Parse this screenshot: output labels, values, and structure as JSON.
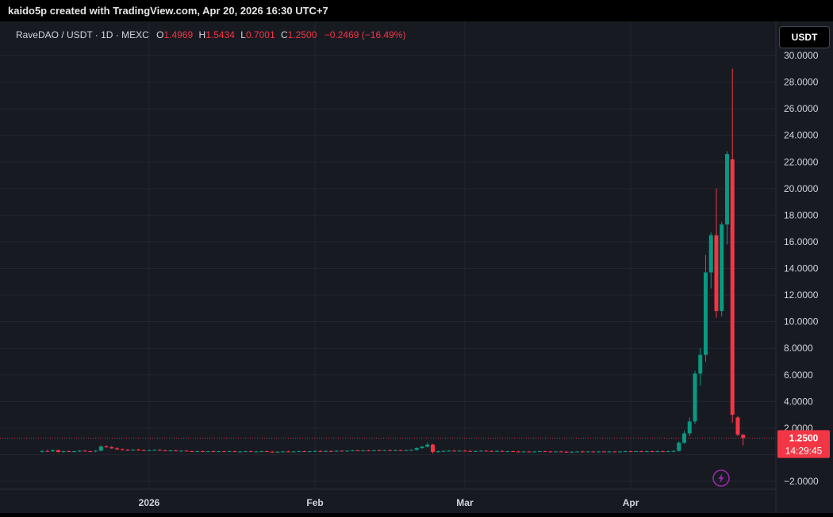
{
  "header": {
    "attribution": "kaido5p created with TradingView.com, Apr 20, 2026 16:30 UTC+7"
  },
  "legend": {
    "symbol": "RaveDAO / USDT · 1D · MEXC",
    "open_label": "O",
    "open": "1.4969",
    "high_label": "H",
    "high": "1.5434",
    "low_label": "L",
    "low": "0.7001",
    "close_label": "C",
    "close": "1.2500",
    "change": "−0.2469 (−16.49%)"
  },
  "toolbar": {
    "currency_label": "USDT"
  },
  "price_tag": {
    "price": "1.2500",
    "countdown": "14:29:45"
  },
  "icons": {
    "bolt": "lightning-bolt-icon"
  },
  "colors": {
    "bullish": "#089981",
    "bearish": "#f23645",
    "background": "#181a22",
    "grid": "#232630",
    "text": "#d1d4dc",
    "bolt": "#9c27b0"
  },
  "chart_data": {
    "type": "candlestick",
    "interval": "1D",
    "exchange": "MEXC",
    "symbol": "RaveDAO / USDT",
    "ylim": [
      -3,
      31
    ],
    "y_ticks": [
      "30.0000",
      "28.0000",
      "26.0000",
      "24.0000",
      "22.0000",
      "20.0000",
      "18.0000",
      "16.0000",
      "14.0000",
      "12.0000",
      "10.0000",
      "8.0000",
      "6.0000",
      "4.0000",
      "2.0000",
      "−2.0000"
    ],
    "y_tick_values": [
      30,
      28,
      26,
      24,
      22,
      20,
      18,
      16,
      14,
      12,
      10,
      8,
      6,
      4,
      2,
      -2
    ],
    "x_labels": [
      "2026",
      "Feb",
      "Mar",
      "Apr"
    ],
    "x_label_dates": [
      "2026-01-01",
      "2026-02-01",
      "2026-03-01",
      "2026-04-01"
    ],
    "grid": true,
    "last_price": 1.25,
    "candles": [
      {
        "date": "2025-12-12",
        "open": 0.22,
        "high": 0.34,
        "low": 0.16,
        "close": 0.28
      },
      {
        "date": "2025-12-13",
        "open": 0.28,
        "high": 0.36,
        "low": 0.2,
        "close": 0.26
      },
      {
        "date": "2025-12-14",
        "open": 0.26,
        "high": 0.4,
        "low": 0.2,
        "close": 0.34
      },
      {
        "date": "2025-12-15",
        "open": 0.34,
        "high": 0.38,
        "low": 0.16,
        "close": 0.2
      },
      {
        "date": "2025-12-16",
        "open": 0.2,
        "high": 0.3,
        "low": 0.16,
        "close": 0.26
      },
      {
        "date": "2025-12-17",
        "open": 0.26,
        "high": 0.32,
        "low": 0.2,
        "close": 0.24
      },
      {
        "date": "2025-12-18",
        "open": 0.24,
        "high": 0.3,
        "low": 0.18,
        "close": 0.26
      },
      {
        "date": "2025-12-19",
        "open": 0.26,
        "high": 0.34,
        "low": 0.2,
        "close": 0.3
      },
      {
        "date": "2025-12-20",
        "open": 0.3,
        "high": 0.36,
        "low": 0.24,
        "close": 0.26
      },
      {
        "date": "2025-12-21",
        "open": 0.26,
        "high": 0.3,
        "low": 0.2,
        "close": 0.24
      },
      {
        "date": "2025-12-22",
        "open": 0.24,
        "high": 0.34,
        "low": 0.18,
        "close": 0.3
      },
      {
        "date": "2025-12-23",
        "open": 0.3,
        "high": 0.7,
        "low": 0.26,
        "close": 0.62
      },
      {
        "date": "2025-12-24",
        "open": 0.62,
        "high": 0.72,
        "low": 0.5,
        "close": 0.56
      },
      {
        "date": "2025-12-25",
        "open": 0.56,
        "high": 0.66,
        "low": 0.44,
        "close": 0.48
      },
      {
        "date": "2025-12-26",
        "open": 0.48,
        "high": 0.56,
        "low": 0.36,
        "close": 0.4
      },
      {
        "date": "2025-12-27",
        "open": 0.4,
        "high": 0.48,
        "low": 0.32,
        "close": 0.36
      },
      {
        "date": "2025-12-28",
        "open": 0.36,
        "high": 0.44,
        "low": 0.28,
        "close": 0.32
      },
      {
        "date": "2025-12-29",
        "open": 0.32,
        "high": 0.42,
        "low": 0.28,
        "close": 0.38
      },
      {
        "date": "2025-12-30",
        "open": 0.38,
        "high": 0.44,
        "low": 0.3,
        "close": 0.34
      },
      {
        "date": "2025-12-31",
        "open": 0.34,
        "high": 0.4,
        "low": 0.28,
        "close": 0.3
      },
      {
        "date": "2026-01-01",
        "open": 0.3,
        "high": 0.38,
        "low": 0.26,
        "close": 0.34
      },
      {
        "date": "2026-01-02",
        "open": 0.34,
        "high": 0.4,
        "low": 0.28,
        "close": 0.36
      },
      {
        "date": "2026-01-03",
        "open": 0.36,
        "high": 0.42,
        "low": 0.3,
        "close": 0.32
      },
      {
        "date": "2026-01-04",
        "open": 0.32,
        "high": 0.38,
        "low": 0.26,
        "close": 0.3
      },
      {
        "date": "2026-01-05",
        "open": 0.3,
        "high": 0.36,
        "low": 0.24,
        "close": 0.32
      },
      {
        "date": "2026-01-06",
        "open": 0.32,
        "high": 0.38,
        "low": 0.26,
        "close": 0.28
      },
      {
        "date": "2026-01-07",
        "open": 0.28,
        "high": 0.34,
        "low": 0.22,
        "close": 0.3
      },
      {
        "date": "2026-01-08",
        "open": 0.3,
        "high": 0.34,
        "low": 0.24,
        "close": 0.26
      },
      {
        "date": "2026-01-09",
        "open": 0.26,
        "high": 0.32,
        "low": 0.2,
        "close": 0.24
      },
      {
        "date": "2026-01-10",
        "open": 0.24,
        "high": 0.3,
        "low": 0.2,
        "close": 0.26
      },
      {
        "date": "2026-01-11",
        "open": 0.26,
        "high": 0.32,
        "low": 0.2,
        "close": 0.24
      },
      {
        "date": "2026-01-12",
        "open": 0.24,
        "high": 0.28,
        "low": 0.18,
        "close": 0.26
      },
      {
        "date": "2026-01-13",
        "open": 0.26,
        "high": 0.32,
        "low": 0.2,
        "close": 0.22
      },
      {
        "date": "2026-01-14",
        "open": 0.22,
        "high": 0.28,
        "low": 0.18,
        "close": 0.26
      },
      {
        "date": "2026-01-15",
        "open": 0.26,
        "high": 0.3,
        "low": 0.2,
        "close": 0.24
      },
      {
        "date": "2026-01-16",
        "open": 0.24,
        "high": 0.3,
        "low": 0.2,
        "close": 0.26
      },
      {
        "date": "2026-01-17",
        "open": 0.26,
        "high": 0.3,
        "low": 0.2,
        "close": 0.22
      },
      {
        "date": "2026-01-18",
        "open": 0.22,
        "high": 0.28,
        "low": 0.18,
        "close": 0.24
      },
      {
        "date": "2026-01-19",
        "open": 0.24,
        "high": 0.3,
        "low": 0.18,
        "close": 0.26
      },
      {
        "date": "2026-01-20",
        "open": 0.26,
        "high": 0.3,
        "low": 0.2,
        "close": 0.22
      },
      {
        "date": "2026-01-21",
        "open": 0.22,
        "high": 0.28,
        "low": 0.18,
        "close": 0.24
      },
      {
        "date": "2026-01-22",
        "open": 0.24,
        "high": 0.3,
        "low": 0.2,
        "close": 0.26
      },
      {
        "date": "2026-01-23",
        "open": 0.26,
        "high": 0.3,
        "low": 0.2,
        "close": 0.22
      },
      {
        "date": "2026-01-24",
        "open": 0.22,
        "high": 0.28,
        "low": 0.16,
        "close": 0.2
      },
      {
        "date": "2026-01-25",
        "open": 0.2,
        "high": 0.26,
        "low": 0.14,
        "close": 0.22
      },
      {
        "date": "2026-01-26",
        "open": 0.22,
        "high": 0.28,
        "low": 0.18,
        "close": 0.24
      },
      {
        "date": "2026-01-27",
        "open": 0.24,
        "high": 0.3,
        "low": 0.2,
        "close": 0.22
      },
      {
        "date": "2026-01-28",
        "open": 0.22,
        "high": 0.28,
        "low": 0.18,
        "close": 0.24
      },
      {
        "date": "2026-01-29",
        "open": 0.24,
        "high": 0.3,
        "low": 0.2,
        "close": 0.26
      },
      {
        "date": "2026-01-30",
        "open": 0.26,
        "high": 0.3,
        "low": 0.2,
        "close": 0.24
      },
      {
        "date": "2026-01-31",
        "open": 0.24,
        "high": 0.28,
        "low": 0.18,
        "close": 0.26
      },
      {
        "date": "2026-02-01",
        "open": 0.26,
        "high": 0.32,
        "low": 0.2,
        "close": 0.28
      },
      {
        "date": "2026-02-02",
        "open": 0.28,
        "high": 0.34,
        "low": 0.22,
        "close": 0.26
      },
      {
        "date": "2026-02-03",
        "open": 0.26,
        "high": 0.32,
        "low": 0.2,
        "close": 0.28
      },
      {
        "date": "2026-02-04",
        "open": 0.28,
        "high": 0.32,
        "low": 0.22,
        "close": 0.26
      },
      {
        "date": "2026-02-05",
        "open": 0.26,
        "high": 0.32,
        "low": 0.2,
        "close": 0.3
      },
      {
        "date": "2026-02-06",
        "open": 0.3,
        "high": 0.34,
        "low": 0.24,
        "close": 0.28
      },
      {
        "date": "2026-02-07",
        "open": 0.28,
        "high": 0.32,
        "low": 0.22,
        "close": 0.3
      },
      {
        "date": "2026-02-08",
        "open": 0.3,
        "high": 0.36,
        "low": 0.26,
        "close": 0.32
      },
      {
        "date": "2026-02-09",
        "open": 0.32,
        "high": 0.36,
        "low": 0.26,
        "close": 0.3
      },
      {
        "date": "2026-02-10",
        "open": 0.3,
        "high": 0.34,
        "low": 0.24,
        "close": 0.32
      },
      {
        "date": "2026-02-11",
        "open": 0.32,
        "high": 0.36,
        "low": 0.26,
        "close": 0.3
      },
      {
        "date": "2026-02-12",
        "open": 0.3,
        "high": 0.36,
        "low": 0.24,
        "close": 0.34
      },
      {
        "date": "2026-02-13",
        "open": 0.34,
        "high": 0.38,
        "low": 0.28,
        "close": 0.32
      },
      {
        "date": "2026-02-14",
        "open": 0.32,
        "high": 0.36,
        "low": 0.26,
        "close": 0.34
      },
      {
        "date": "2026-02-15",
        "open": 0.34,
        "high": 0.38,
        "low": 0.28,
        "close": 0.32
      },
      {
        "date": "2026-02-16",
        "open": 0.32,
        "high": 0.38,
        "low": 0.28,
        "close": 0.34
      },
      {
        "date": "2026-02-17",
        "open": 0.34,
        "high": 0.38,
        "low": 0.28,
        "close": 0.32
      },
      {
        "date": "2026-02-18",
        "open": 0.32,
        "high": 0.36,
        "low": 0.26,
        "close": 0.34
      },
      {
        "date": "2026-02-19",
        "open": 0.34,
        "high": 0.4,
        "low": 0.3,
        "close": 0.36
      },
      {
        "date": "2026-02-20",
        "open": 0.36,
        "high": 0.56,
        "low": 0.3,
        "close": 0.5
      },
      {
        "date": "2026-02-21",
        "open": 0.5,
        "high": 0.66,
        "low": 0.44,
        "close": 0.6
      },
      {
        "date": "2026-02-22",
        "open": 0.6,
        "high": 0.9,
        "low": 0.54,
        "close": 0.76
      },
      {
        "date": "2026-02-23",
        "open": 0.76,
        "high": 0.82,
        "low": 0.1,
        "close": 0.2
      },
      {
        "date": "2026-02-24",
        "open": 0.2,
        "high": 0.3,
        "low": 0.14,
        "close": 0.26
      },
      {
        "date": "2026-02-25",
        "open": 0.26,
        "high": 0.32,
        "low": 0.2,
        "close": 0.28
      },
      {
        "date": "2026-02-26",
        "open": 0.28,
        "high": 0.34,
        "low": 0.22,
        "close": 0.3
      },
      {
        "date": "2026-02-27",
        "open": 0.3,
        "high": 0.36,
        "low": 0.24,
        "close": 0.28
      },
      {
        "date": "2026-02-28",
        "open": 0.28,
        "high": 0.34,
        "low": 0.22,
        "close": 0.3
      },
      {
        "date": "2026-03-01",
        "open": 0.3,
        "high": 0.36,
        "low": 0.24,
        "close": 0.28
      },
      {
        "date": "2026-03-02",
        "open": 0.28,
        "high": 0.34,
        "low": 0.22,
        "close": 0.26
      },
      {
        "date": "2026-03-03",
        "open": 0.26,
        "high": 0.32,
        "low": 0.2,
        "close": 0.28
      },
      {
        "date": "2026-03-04",
        "open": 0.28,
        "high": 0.34,
        "low": 0.22,
        "close": 0.3
      },
      {
        "date": "2026-03-05",
        "open": 0.3,
        "high": 0.34,
        "low": 0.24,
        "close": 0.28
      },
      {
        "date": "2026-03-06",
        "open": 0.28,
        "high": 0.32,
        "low": 0.22,
        "close": 0.26
      },
      {
        "date": "2026-03-07",
        "open": 0.26,
        "high": 0.32,
        "low": 0.2,
        "close": 0.28
      },
      {
        "date": "2026-03-08",
        "open": 0.28,
        "high": 0.32,
        "low": 0.22,
        "close": 0.24
      },
      {
        "date": "2026-03-09",
        "open": 0.24,
        "high": 0.3,
        "low": 0.2,
        "close": 0.26
      },
      {
        "date": "2026-03-10",
        "open": 0.26,
        "high": 0.3,
        "low": 0.2,
        "close": 0.24
      },
      {
        "date": "2026-03-11",
        "open": 0.24,
        "high": 0.3,
        "low": 0.18,
        "close": 0.22
      },
      {
        "date": "2026-03-12",
        "open": 0.22,
        "high": 0.28,
        "low": 0.18,
        "close": 0.24
      },
      {
        "date": "2026-03-13",
        "open": 0.24,
        "high": 0.28,
        "low": 0.18,
        "close": 0.22
      },
      {
        "date": "2026-03-14",
        "open": 0.22,
        "high": 0.28,
        "low": 0.18,
        "close": 0.24
      },
      {
        "date": "2026-03-15",
        "open": 0.24,
        "high": 0.3,
        "low": 0.2,
        "close": 0.26
      },
      {
        "date": "2026-03-16",
        "open": 0.26,
        "high": 0.3,
        "low": 0.2,
        "close": 0.24
      },
      {
        "date": "2026-03-17",
        "open": 0.24,
        "high": 0.28,
        "low": 0.18,
        "close": 0.22
      },
      {
        "date": "2026-03-18",
        "open": 0.22,
        "high": 0.28,
        "low": 0.18,
        "close": 0.24
      },
      {
        "date": "2026-03-19",
        "open": 0.24,
        "high": 0.3,
        "low": 0.2,
        "close": 0.22
      },
      {
        "date": "2026-03-20",
        "open": 0.22,
        "high": 0.28,
        "low": 0.16,
        "close": 0.2
      },
      {
        "date": "2026-03-21",
        "open": 0.2,
        "high": 0.26,
        "low": 0.14,
        "close": 0.22
      },
      {
        "date": "2026-03-22",
        "open": 0.22,
        "high": 0.28,
        "low": 0.18,
        "close": 0.24
      },
      {
        "date": "2026-03-23",
        "open": 0.24,
        "high": 0.3,
        "low": 0.2,
        "close": 0.22
      },
      {
        "date": "2026-03-24",
        "open": 0.22,
        "high": 0.28,
        "low": 0.18,
        "close": 0.24
      },
      {
        "date": "2026-03-25",
        "open": 0.24,
        "high": 0.28,
        "low": 0.18,
        "close": 0.22
      },
      {
        "date": "2026-03-26",
        "open": 0.22,
        "high": 0.28,
        "low": 0.18,
        "close": 0.24
      },
      {
        "date": "2026-03-27",
        "open": 0.24,
        "high": 0.28,
        "low": 0.2,
        "close": 0.22
      },
      {
        "date": "2026-03-28",
        "open": 0.22,
        "high": 0.28,
        "low": 0.18,
        "close": 0.24
      },
      {
        "date": "2026-03-29",
        "open": 0.24,
        "high": 0.28,
        "low": 0.2,
        "close": 0.22
      },
      {
        "date": "2026-03-30",
        "open": 0.22,
        "high": 0.28,
        "low": 0.18,
        "close": 0.24
      },
      {
        "date": "2026-03-31",
        "open": 0.24,
        "high": 0.3,
        "low": 0.2,
        "close": 0.26
      },
      {
        "date": "2026-04-01",
        "open": 0.26,
        "high": 0.3,
        "low": 0.2,
        "close": 0.24
      },
      {
        "date": "2026-04-02",
        "open": 0.24,
        "high": 0.3,
        "low": 0.2,
        "close": 0.26
      },
      {
        "date": "2026-04-03",
        "open": 0.26,
        "high": 0.3,
        "low": 0.2,
        "close": 0.24
      },
      {
        "date": "2026-04-04",
        "open": 0.24,
        "high": 0.3,
        "low": 0.2,
        "close": 0.26
      },
      {
        "date": "2026-04-05",
        "open": 0.26,
        "high": 0.3,
        "low": 0.2,
        "close": 0.24
      },
      {
        "date": "2026-04-06",
        "open": 0.24,
        "high": 0.3,
        "low": 0.2,
        "close": 0.26
      },
      {
        "date": "2026-04-07",
        "open": 0.26,
        "high": 0.3,
        "low": 0.2,
        "close": 0.24
      },
      {
        "date": "2026-04-08",
        "open": 0.24,
        "high": 0.3,
        "low": 0.2,
        "close": 0.26
      },
      {
        "date": "2026-04-09",
        "open": 0.26,
        "high": 0.32,
        "low": 0.2,
        "close": 0.28
      },
      {
        "date": "2026-04-10",
        "open": 0.28,
        "high": 1.0,
        "low": 0.24,
        "close": 0.9
      },
      {
        "date": "2026-04-11",
        "open": 0.9,
        "high": 1.8,
        "low": 0.8,
        "close": 1.6
      },
      {
        "date": "2026-04-12",
        "open": 1.6,
        "high": 2.8,
        "low": 1.4,
        "close": 2.5
      },
      {
        "date": "2026-04-13",
        "open": 2.5,
        "high": 6.3,
        "low": 2.3,
        "close": 6.1
      },
      {
        "date": "2026-04-14",
        "open": 6.1,
        "high": 8.0,
        "low": 5.2,
        "close": 7.5
      },
      {
        "date": "2026-04-15",
        "open": 7.5,
        "high": 15.0,
        "low": 7.0,
        "close": 13.7
      },
      {
        "date": "2026-04-16",
        "open": 13.7,
        "high": 16.7,
        "low": 12.5,
        "close": 16.5
      },
      {
        "date": "2026-04-17",
        "open": 16.5,
        "high": 20.0,
        "low": 10.3,
        "close": 10.8
      },
      {
        "date": "2026-04-18",
        "open": 10.8,
        "high": 17.5,
        "low": 10.4,
        "close": 17.3
      },
      {
        "date": "2026-04-19",
        "open": 17.3,
        "high": 22.8,
        "low": 15.8,
        "close": 22.6
      },
      {
        "date": "2026-04-20",
        "open": 22.2,
        "high": 29.0,
        "low": 2.4,
        "close": 3.0
      },
      {
        "date": "2026-04-21",
        "open": 2.8,
        "high": 2.9,
        "low": 1.4,
        "close": 1.5
      },
      {
        "date": "2026-04-22",
        "open": 1.4969,
        "high": 1.5434,
        "low": 0.7001,
        "close": 1.25
      }
    ]
  }
}
